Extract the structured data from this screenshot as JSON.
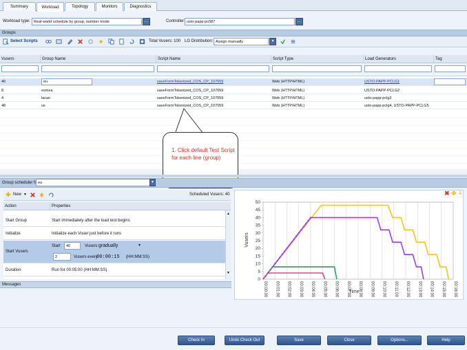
{
  "tabs": [
    "Summary",
    "Workload",
    "Topology",
    "Monitors",
    "Diagnostics"
  ],
  "active_tab": "Workload",
  "workload": {
    "label": "Workload type:",
    "value": "Real-world schedule by group, number mode",
    "controller_label": "Controller:",
    "controller_value": "usto-papp-pc087"
  },
  "groups": {
    "title": "Groups",
    "toolbar": {
      "select_scripts": "Select Scripts",
      "total_vusers": "Total Vusers: 100",
      "lg_label": "LG Distribution:",
      "lg_value": "Assign manually"
    },
    "columns": [
      "Vusers",
      "Group Name",
      "Script Name",
      "Script Type",
      "Load Generators",
      "Tag"
    ],
    "rows": [
      {
        "vusers": "40",
        "group": "eu",
        "script": "saveFormTokenized_COS_CP_107059",
        "type": "Web (HTTP/HTML)",
        "lg": "USTO-PAPP-PCLG1"
      },
      {
        "vusers": "8",
        "group": "esmea",
        "script": "saveFormTokenized_COS_CP_107059",
        "type": "Web (HTTP/HTML)",
        "lg": "USTO-PAPP-PCLG2"
      },
      {
        "vusers": "4",
        "group": "lacan",
        "script": "saveFormTokenized_COS_CP_107059",
        "type": "Web (HTTP/HTML)",
        "lg": "usto-papp-pclg3"
      },
      {
        "vusers": "48",
        "group": "us",
        "script": "saveFormTokenized_COS_CP_107059",
        "type": "Web (HTTP/HTML)",
        "lg": "usto-papp-pclg4, USTO-PAPP-PCLG5"
      }
    ]
  },
  "callout": "1. Click default Test Script for each line (group)",
  "scheduler": {
    "label": "Group scheduler for:",
    "value": "eu",
    "new_label": "New",
    "scheduled_vusers": "Scheduled Vusers: 40",
    "columns": [
      "Action",
      "Properties"
    ],
    "rows": [
      {
        "action": "Start Group",
        "props": "Start immediately after the load test begins"
      },
      {
        "action": "Initialize",
        "props": "Initialize each Vuser just before it runs"
      },
      {
        "action": "Start Vusers",
        "start_label": "Start",
        "start_value": "40",
        "vusers_label": "Vusers",
        "mode": "gradually",
        "step_value": "2",
        "every_label": "Vusers every",
        "time": "00:00:15",
        "time_fmt": "(HH:MM:SS)"
      },
      {
        "action": "Duration",
        "props": "Run for 00:05:00 (HH:MM:SS)"
      }
    ]
  },
  "messages": "Messages",
  "chart_data": {
    "type": "line",
    "xlabel": "Time",
    "ylabel": "Vusers",
    "ylim": [
      0,
      50
    ],
    "yticks": [
      0,
      5,
      10,
      15,
      20,
      25,
      30,
      35,
      40,
      45,
      50
    ],
    "xticks": [
      "00:00:00",
      "00:01:00",
      "00:02:00",
      "00:03:00",
      "00:04:00",
      "00:05:00",
      "00:06:00",
      "00:07:00",
      "00:08:00",
      "00:09:00",
      "00:10:00",
      "00:11:00",
      "00:12:00",
      "00:13:00",
      "00:14:00",
      "00:15:00",
      "00:16:00"
    ],
    "series": [
      {
        "color": "#f5c518",
        "points": [
          [
            0,
            0
          ],
          [
            4.9,
            48
          ],
          [
            10.5,
            48
          ],
          [
            10.9,
            40
          ],
          [
            11.6,
            40
          ],
          [
            11.9,
            32
          ],
          [
            12.6,
            32
          ],
          [
            12.9,
            24
          ],
          [
            13.6,
            24
          ],
          [
            13.9,
            16
          ],
          [
            14.6,
            16
          ],
          [
            14.9,
            8
          ],
          [
            15.4,
            8
          ],
          [
            15.6,
            0
          ]
        ]
      },
      {
        "color": "#9b3cf0",
        "points": [
          [
            0,
            0
          ],
          [
            4.0,
            40
          ],
          [
            9.6,
            40
          ],
          [
            9.9,
            32
          ],
          [
            10.6,
            32
          ],
          [
            10.9,
            24
          ],
          [
            11.6,
            24
          ],
          [
            11.9,
            16
          ],
          [
            12.6,
            16
          ],
          [
            12.9,
            8
          ],
          [
            13.3,
            8
          ],
          [
            13.5,
            0
          ]
        ]
      },
      {
        "color": "#2e9e5b",
        "points": [
          [
            0,
            0
          ],
          [
            0.8,
            8
          ],
          [
            6.0,
            8
          ],
          [
            6.2,
            0
          ]
        ]
      },
      {
        "color": "#e0457b",
        "points": [
          [
            0,
            0
          ],
          [
            0.4,
            4
          ],
          [
            5.0,
            4
          ],
          [
            5.2,
            0
          ]
        ]
      }
    ]
  },
  "buttons": {
    "check_in": "Check In",
    "undo": "Undo Check Out",
    "save": "Save",
    "close": "Close",
    "options": "Options...",
    "help": "Help"
  }
}
